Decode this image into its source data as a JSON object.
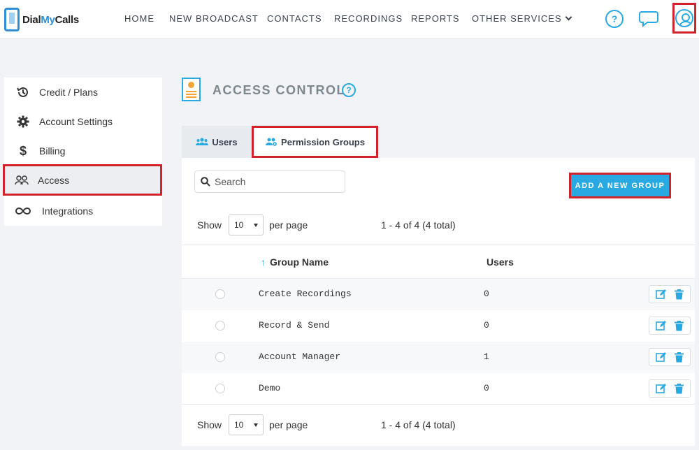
{
  "app": {
    "logo_text_main": "Dial",
    "logo_text_accent": "My",
    "logo_text_end": "Calls"
  },
  "nav": {
    "items": [
      "HOME",
      "NEW BROADCAST",
      "CONTACTS",
      "RECORDINGS",
      "REPORTS",
      "OTHER SERVICES"
    ],
    "help_glyph": "?"
  },
  "sidebar": {
    "items": [
      {
        "label": "Credit / Plans",
        "icon": "history-icon"
      },
      {
        "label": "Account Settings",
        "icon": "gear-icon"
      },
      {
        "label": "Billing",
        "icon": "dollar-icon"
      },
      {
        "label": "Access",
        "icon": "users-icon"
      },
      {
        "label": "Integrations",
        "icon": "infinity-icon"
      }
    ],
    "active_index": 3
  },
  "page": {
    "title": "ACCESS CONTROL",
    "help_glyph": "?"
  },
  "tabs": [
    {
      "label": "Users"
    },
    {
      "label": "Permission Groups",
      "active": true
    }
  ],
  "toolbar": {
    "search_placeholder": "Search",
    "add_button_label": "ADD A NEW GROUP"
  },
  "pagination": {
    "show_label": "Show",
    "per_page_value": "10",
    "per_page_label": "per page",
    "range_text": "1 - 4 of 4 (4 total)"
  },
  "table": {
    "columns": [
      "Group Name",
      "Users"
    ],
    "rows": [
      {
        "name": "Create Recordings",
        "users": "0"
      },
      {
        "name": "Record & Send",
        "users": "0"
      },
      {
        "name": "Account Manager",
        "users": "1"
      },
      {
        "name": "Demo",
        "users": "0"
      }
    ]
  },
  "colors": {
    "accent": "#29a9e1",
    "highlight_border": "#d0232b",
    "icon_orange": "#f4a53a"
  }
}
